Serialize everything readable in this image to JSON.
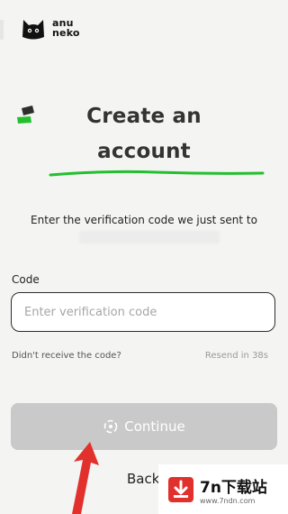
{
  "brand": {
    "name_line1": "anu",
    "name_line2": "neko"
  },
  "heading": {
    "line1": "Create an",
    "line2": "account"
  },
  "verification": {
    "message": "Enter the verification code we just sent to"
  },
  "code_field": {
    "label": "Code",
    "placeholder": "Enter verification code",
    "value": ""
  },
  "resend": {
    "prompt": "Didn't receive the code?",
    "countdown": "Resend in 38s"
  },
  "actions": {
    "continue_label": "Continue",
    "back_label": "Back"
  },
  "watermark": {
    "title": "7n下载站",
    "url": "www.7ndn.com"
  },
  "colors": {
    "accent_green": "#22c02e",
    "button_disabled": "#c9c9c9",
    "arrow_red": "#e2312c"
  }
}
